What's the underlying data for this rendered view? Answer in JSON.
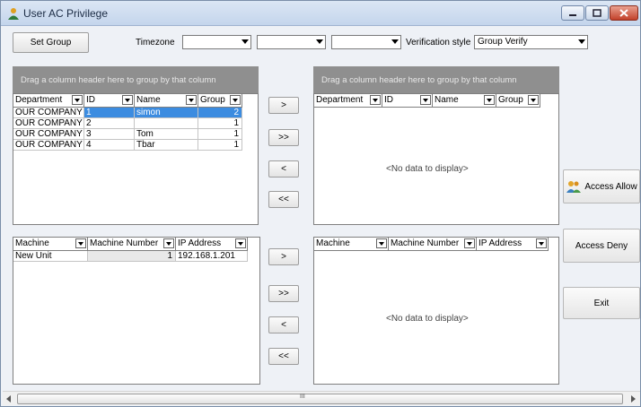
{
  "window": {
    "title": "User AC Privilege"
  },
  "toolbar": {
    "set_group_label": "Set Group",
    "timezone_label": "Timezone",
    "timezone1": "",
    "timezone2": "",
    "timezone3": "",
    "verification_label": "Verification style",
    "verification_value": "Group Verify"
  },
  "user_grid_left": {
    "group_hint": "Drag a column header here to group by that column",
    "columns": [
      "Department",
      "ID",
      "Name",
      "Group"
    ],
    "rows": [
      [
        "OUR COMPANY",
        "1",
        "simon",
        "2"
      ],
      [
        "OUR COMPANY",
        "2",
        "",
        "1"
      ],
      [
        "OUR COMPANY",
        "3",
        "Tom",
        "1"
      ],
      [
        "OUR COMPANY",
        "4",
        "Tbar",
        "1"
      ]
    ]
  },
  "user_grid_right": {
    "group_hint": "Drag a column header here to group by that column",
    "columns": [
      "Department",
      "ID",
      "Name",
      "Group"
    ],
    "empty_text": "<No data to display>"
  },
  "machine_grid_left": {
    "columns": [
      "Machine",
      "Machine Number",
      "IP Address"
    ],
    "rows": [
      [
        "New Unit",
        "1",
        "192.168.1.201"
      ]
    ]
  },
  "machine_grid_right": {
    "columns": [
      "Machine",
      "Machine Number",
      "IP Address"
    ],
    "empty_text": "<No data to display>"
  },
  "move_buttons": {
    "add": ">",
    "add_all": ">>",
    "remove": "<",
    "remove_all": "<<"
  },
  "side_buttons": {
    "access_allow": "Access Allow",
    "access_deny": "Access Deny",
    "exit": "Exit"
  },
  "scrollbar": {
    "grip": "III"
  }
}
